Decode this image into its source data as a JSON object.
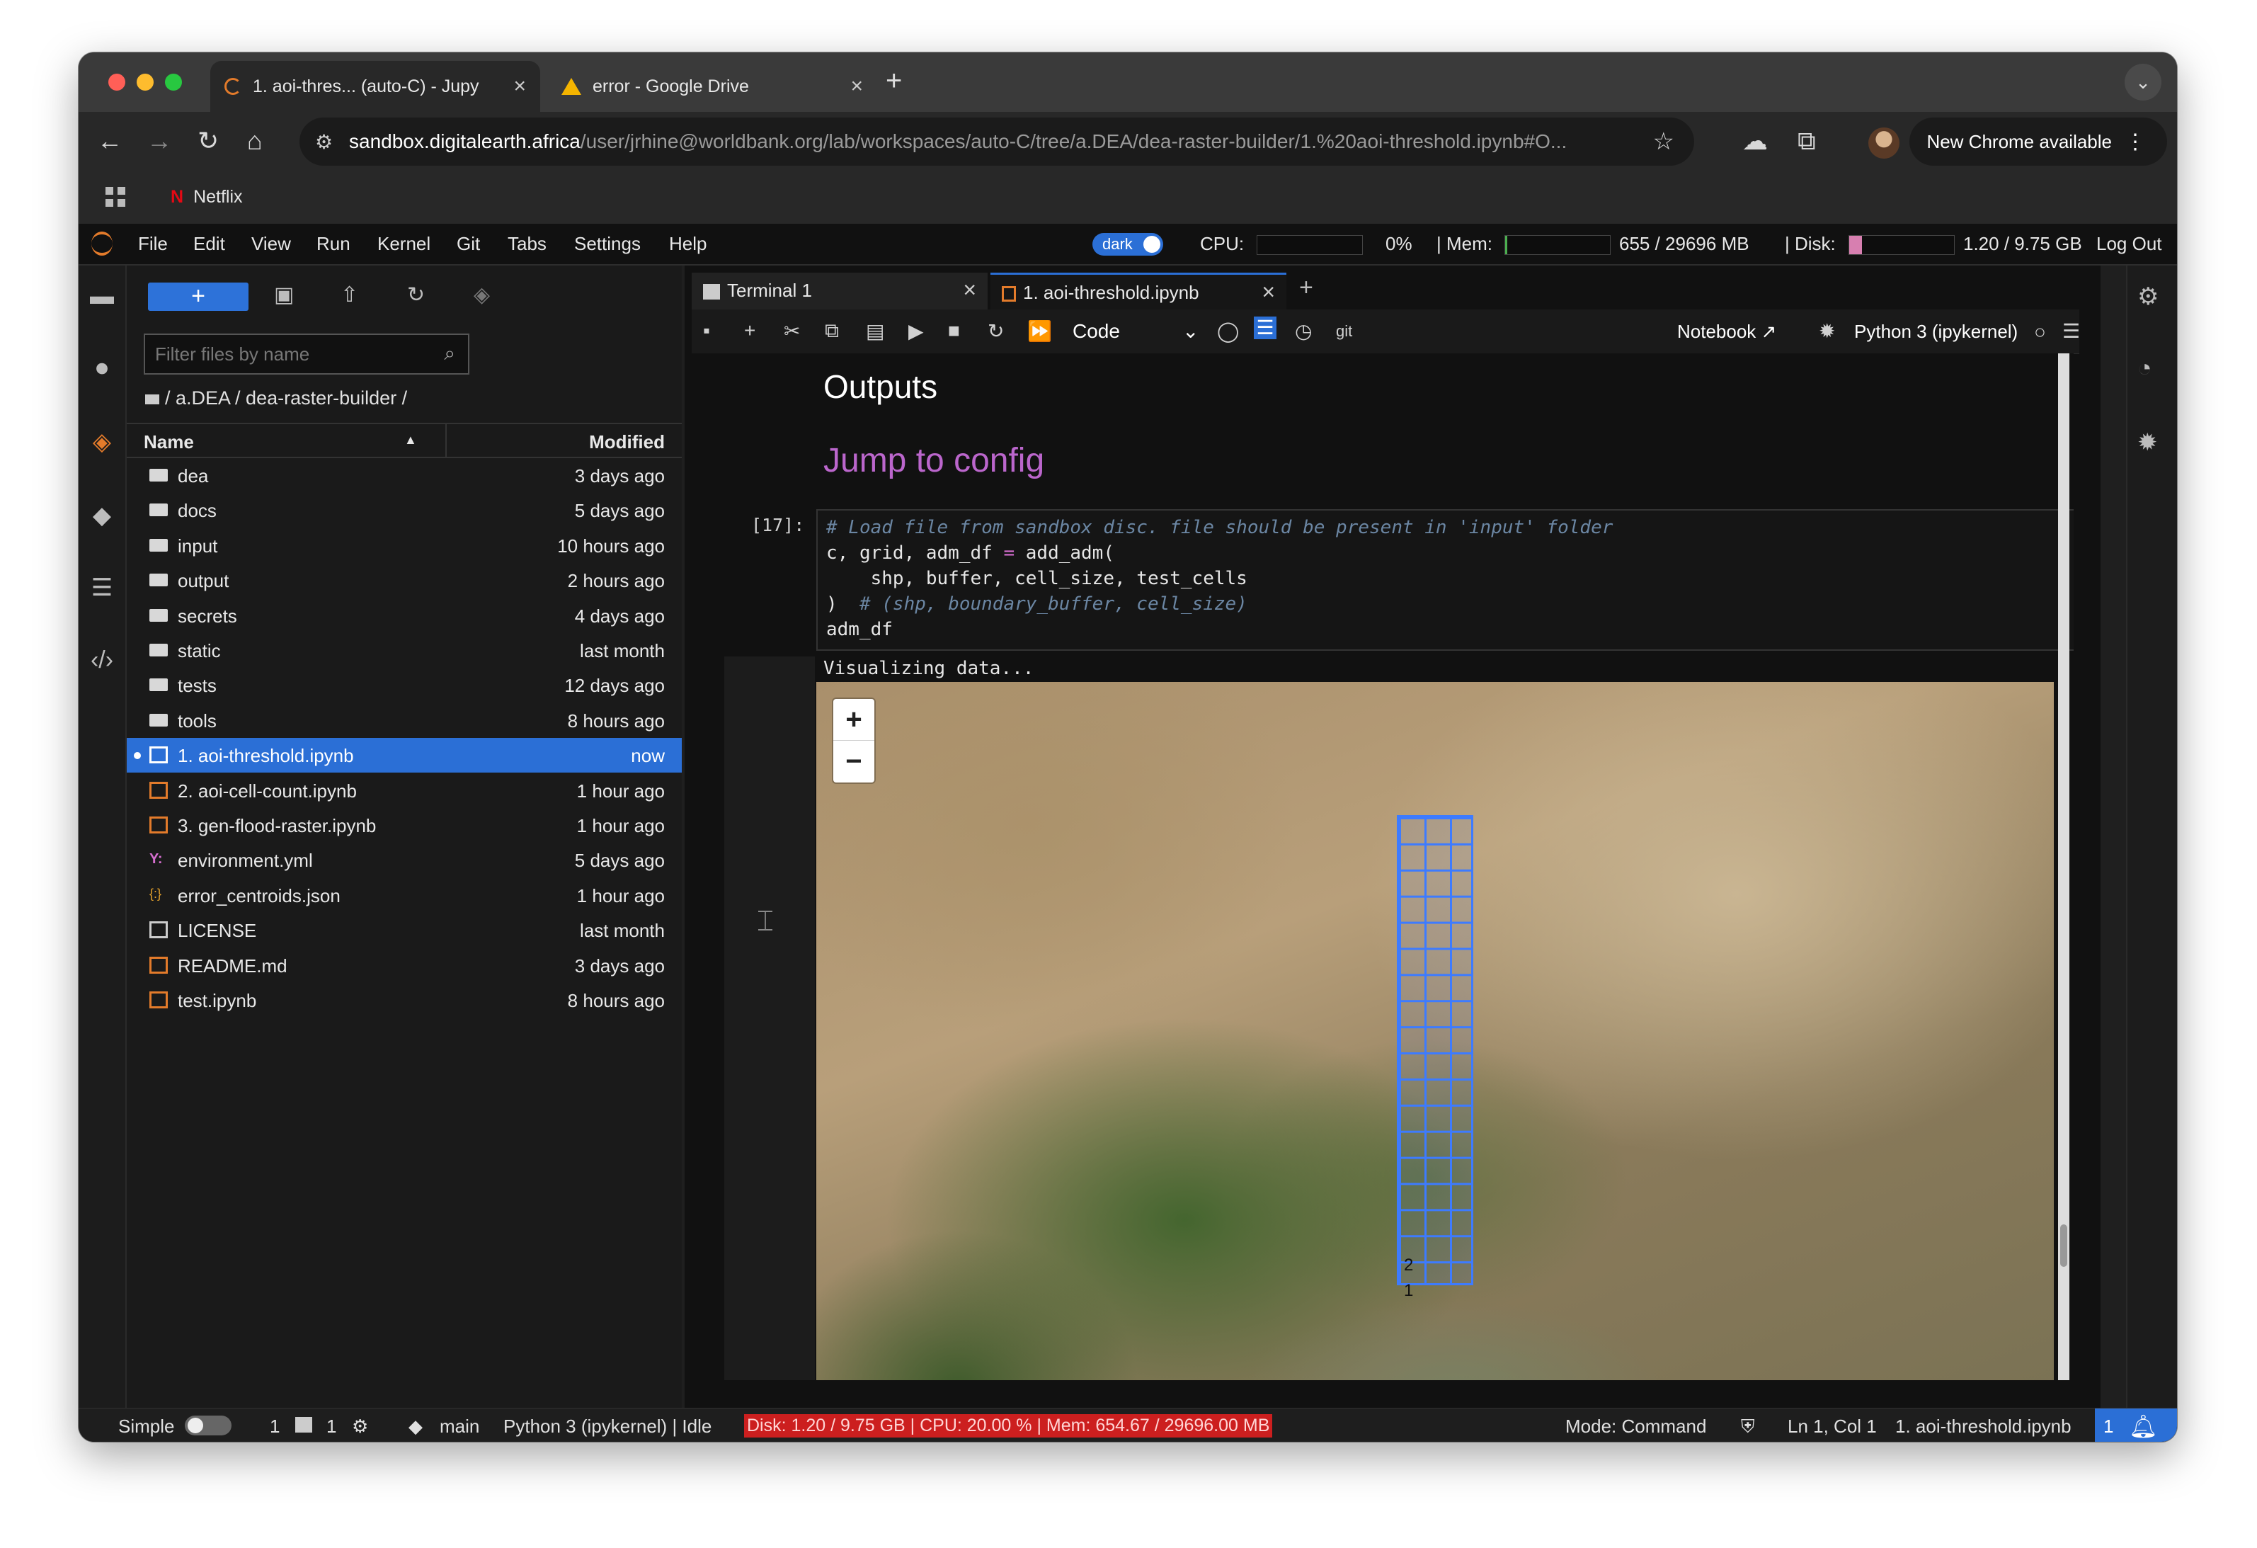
{
  "browser": {
    "tabs": [
      {
        "title": "1. aoi-thres... (auto-C) - Jupy"
      },
      {
        "title": "error - Google Drive"
      }
    ],
    "url_host": "sandbox.digitalearth.africa",
    "url_path": "/user/jrhine@worldbank.org/lab/workspaces/auto-C/tree/a.DEA/dea-raster-builder/1.%20aoi-threshold.ipynb#O...",
    "new_chrome_label": "New Chrome available",
    "bookmark": "Netflix"
  },
  "menubar": {
    "items": [
      "File",
      "Edit",
      "View",
      "Run",
      "Kernel",
      "Git",
      "Tabs",
      "Settings",
      "Help"
    ],
    "theme_toggle": "dark",
    "cpu_label": "CPU:",
    "cpu_value": "0%",
    "mem_label": "| Mem:",
    "mem_value": "655 / 29696 MB",
    "disk_label": "| Disk:",
    "disk_value": "1.20 / 9.75 GB",
    "logout": "Log Out"
  },
  "filebrowser": {
    "filter_placeholder": "Filter files by name",
    "breadcrumb": "/ a.DEA / dea-raster-builder /",
    "col_name": "Name",
    "col_modified": "Modified",
    "files": [
      {
        "name": "dea",
        "modified": "3 days ago",
        "type": "folder"
      },
      {
        "name": "docs",
        "modified": "5 days ago",
        "type": "folder"
      },
      {
        "name": "input",
        "modified": "10 hours ago",
        "type": "folder"
      },
      {
        "name": "output",
        "modified": "2 hours ago",
        "type": "folder"
      },
      {
        "name": "secrets",
        "modified": "4 days ago",
        "type": "folder"
      },
      {
        "name": "static",
        "modified": "last month",
        "type": "folder"
      },
      {
        "name": "tests",
        "modified": "12 days ago",
        "type": "folder"
      },
      {
        "name": "tools",
        "modified": "8 hours ago",
        "type": "folder"
      },
      {
        "name": "1. aoi-threshold.ipynb",
        "modified": "now",
        "type": "notebook"
      },
      {
        "name": "2. aoi-cell-count.ipynb",
        "modified": "1 hour ago",
        "type": "notebook"
      },
      {
        "name": "3. gen-flood-raster.ipynb",
        "modified": "1 hour ago",
        "type": "notebook"
      },
      {
        "name": "environment.yml",
        "modified": "5 days ago",
        "type": "yaml"
      },
      {
        "name": "error_centroids.json",
        "modified": "1 hour ago",
        "type": "json"
      },
      {
        "name": "LICENSE",
        "modified": "last month",
        "type": "file"
      },
      {
        "name": "README.md",
        "modified": "3 days ago",
        "type": "markdown"
      },
      {
        "name": "test.ipynb",
        "modified": "8 hours ago",
        "type": "notebook"
      }
    ]
  },
  "doc_tabs": [
    {
      "title": "Terminal 1"
    },
    {
      "title": "1. aoi-threshold.ipynb"
    }
  ],
  "nbtoolbar": {
    "cell_type": "Code",
    "git_label": "git",
    "notebook_label": "Notebook",
    "kernel_label": "Python 3 (ipykernel)"
  },
  "notebook": {
    "heading": "Outputs",
    "link_heading": "Jump to config",
    "prompt": "[17]:",
    "code_line1": "# Load file from sandbox disc. file should be present in 'input' folder",
    "code_line2_a": "c, grid, adm_df ",
    "code_line2_op": "=",
    "code_line2_b": " add_adm(",
    "code_line3": "    shp, buffer, cell_size, test_cells",
    "code_line4_a": ") ",
    "code_line4_cmt": " # (shp, boundary_buffer, cell_size)",
    "code_line5": "adm_df",
    "output_text": "Visualizing data...",
    "zoom_in": "+",
    "zoom_out": "−",
    "grid_label_2": "2",
    "grid_label_1": "1"
  },
  "statusbar": {
    "mode_label": "Simple",
    "count1": "1",
    "count2": "1",
    "branch": "main",
    "kernel_status": "Python 3 (ipykernel) | Idle",
    "resources": "Disk: 1.20 / 9.75 GB | CPU: 20.00 % | Mem: 654.67 / 29696.00 MB",
    "mode": "Mode: Command",
    "position": "Ln 1, Col 1",
    "filename": "1. aoi-threshold.ipynb",
    "notifications": "1"
  }
}
